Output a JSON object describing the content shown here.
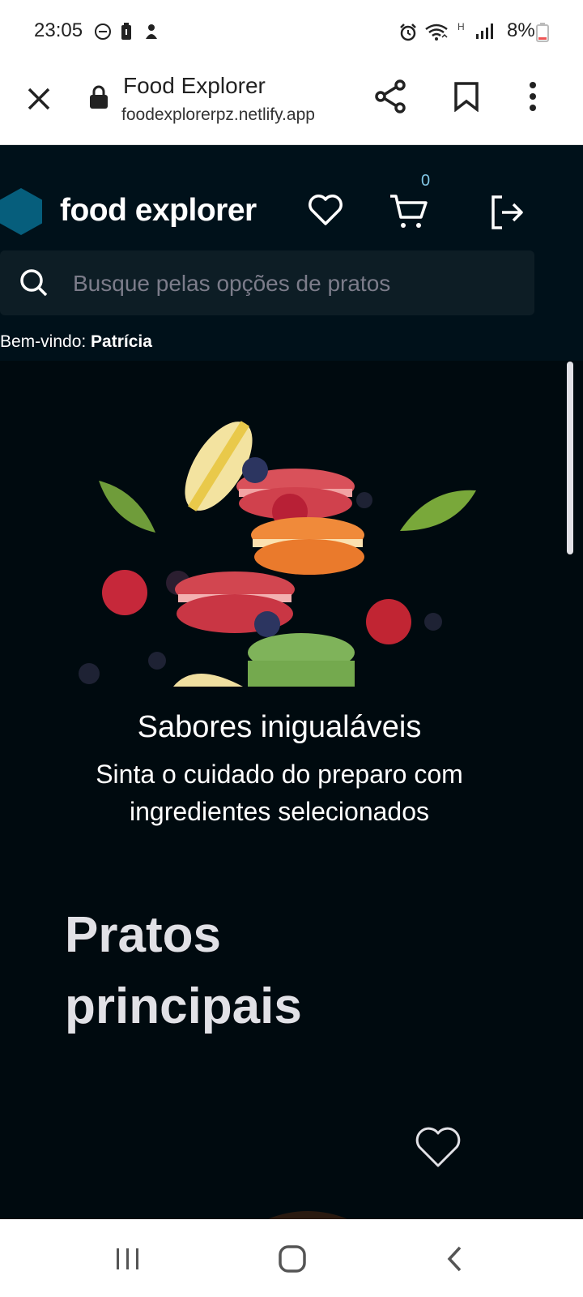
{
  "status_bar": {
    "time": "23:05",
    "battery_percent": "8%",
    "network": "H",
    "icons": [
      "do-not-disturb-icon",
      "battery-saver-icon",
      "notification-icon",
      "alarm-icon",
      "wifi-icon",
      "signal-icon",
      "battery-icon"
    ]
  },
  "browser": {
    "page_title": "Food Explorer",
    "url": "foodexplorerpz.netlify.app",
    "icons": [
      "close-icon",
      "lock-icon",
      "share-icon",
      "bookmark-icon",
      "more-icon"
    ]
  },
  "header": {
    "brand": "food explorer",
    "cart_count": "0",
    "search_placeholder": "Busque pelas opções de pratos",
    "welcome_prefix": "Bem-vindo: ",
    "user_name": "Patrícia",
    "accent_color": "#065e7c",
    "icons": [
      "logo-hexagon-icon",
      "favorites-heart-icon",
      "cart-icon",
      "logout-icon",
      "search-icon"
    ]
  },
  "banner": {
    "title": "Sabores inigualáveis",
    "subtitle": "Sinta o cuidado do preparo com ingredientes selecionados"
  },
  "section": {
    "title": "Pratos principais",
    "icons": [
      "favorite-heart-icon"
    ]
  },
  "nav_bar": {
    "icons": [
      "recent-apps-icon",
      "home-icon",
      "back-icon"
    ]
  }
}
